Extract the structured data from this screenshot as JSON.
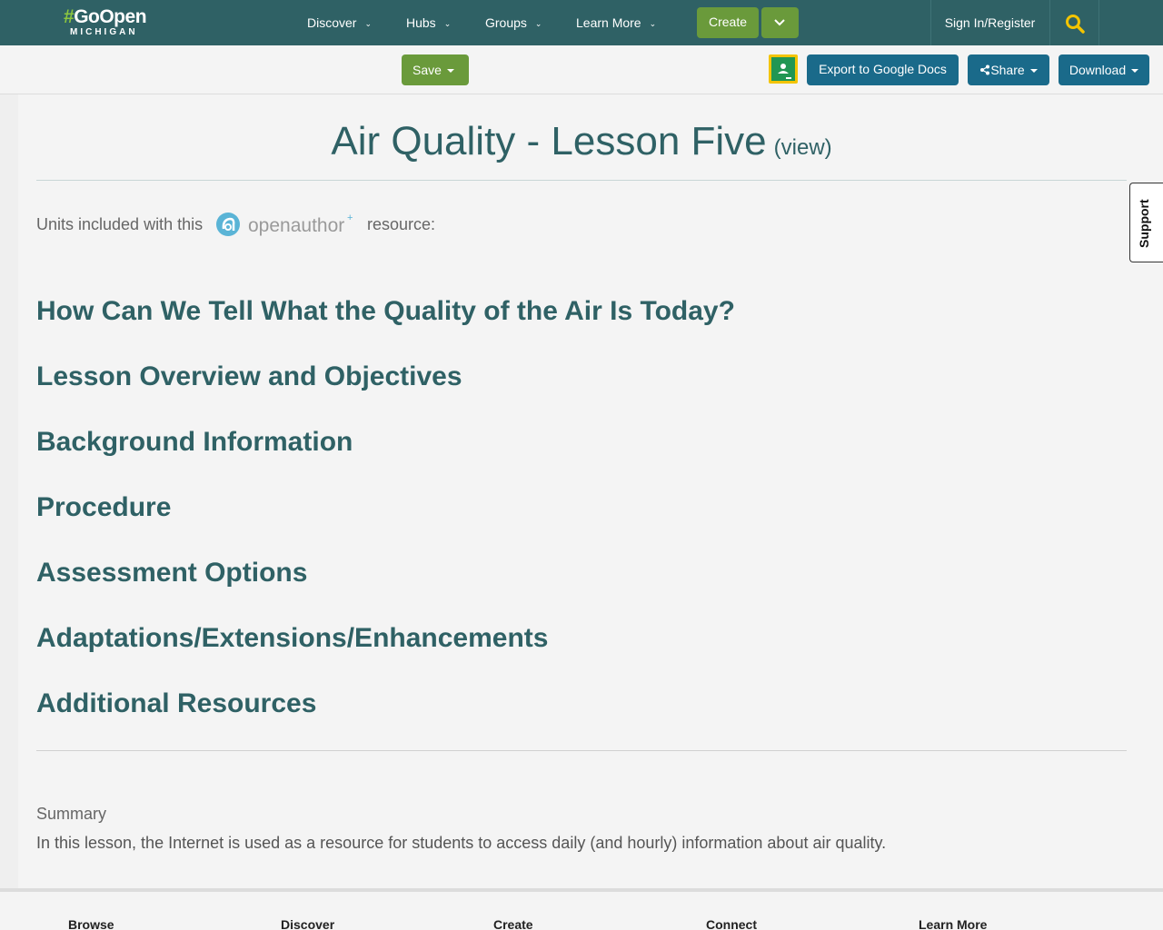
{
  "navbar": {
    "logo_top": "GoOpen",
    "logo_hash": "#",
    "logo_bottom": "MICHIGAN",
    "items": [
      {
        "label": "Discover"
      },
      {
        "label": "Hubs"
      },
      {
        "label": "Groups"
      },
      {
        "label": "Learn More"
      }
    ],
    "create_label": "Create",
    "signin_label": "Sign In/Register",
    "colors": {
      "bar": "#2f6165",
      "green": "#6a9a3b",
      "search_icon": "#f3c400"
    }
  },
  "actionbar": {
    "save_label": "Save",
    "export_label": "Export to Google Docs",
    "share_label": "Share",
    "download_label": "Download",
    "classroom_icon": "google-classroom-icon",
    "colors": {
      "blue": "#1a6a8a"
    }
  },
  "resource": {
    "title": "Air Quality - Lesson Five",
    "view_label": "(view)",
    "units_prefix": "Units included with this",
    "units_logo_text": "openauthor",
    "units_suffix": "resource:",
    "sections": [
      "How Can We Tell What the Quality of the Air Is Today?",
      "Lesson Overview and Objectives",
      "Background Information",
      "Procedure",
      "Assessment Options",
      "Adaptations/Extensions/Enhancements",
      "Additional Resources"
    ],
    "summary_label": "Summary",
    "summary_text": "In this lesson, the Internet is used as a resource for students to access daily (and hourly) information about air quality.",
    "colors": {
      "heading": "#2f6165"
    }
  },
  "support_tab": {
    "label": "Support"
  },
  "footer": {
    "headings": [
      "Browse",
      "Discover",
      "Create",
      "Connect",
      "Learn More"
    ]
  }
}
